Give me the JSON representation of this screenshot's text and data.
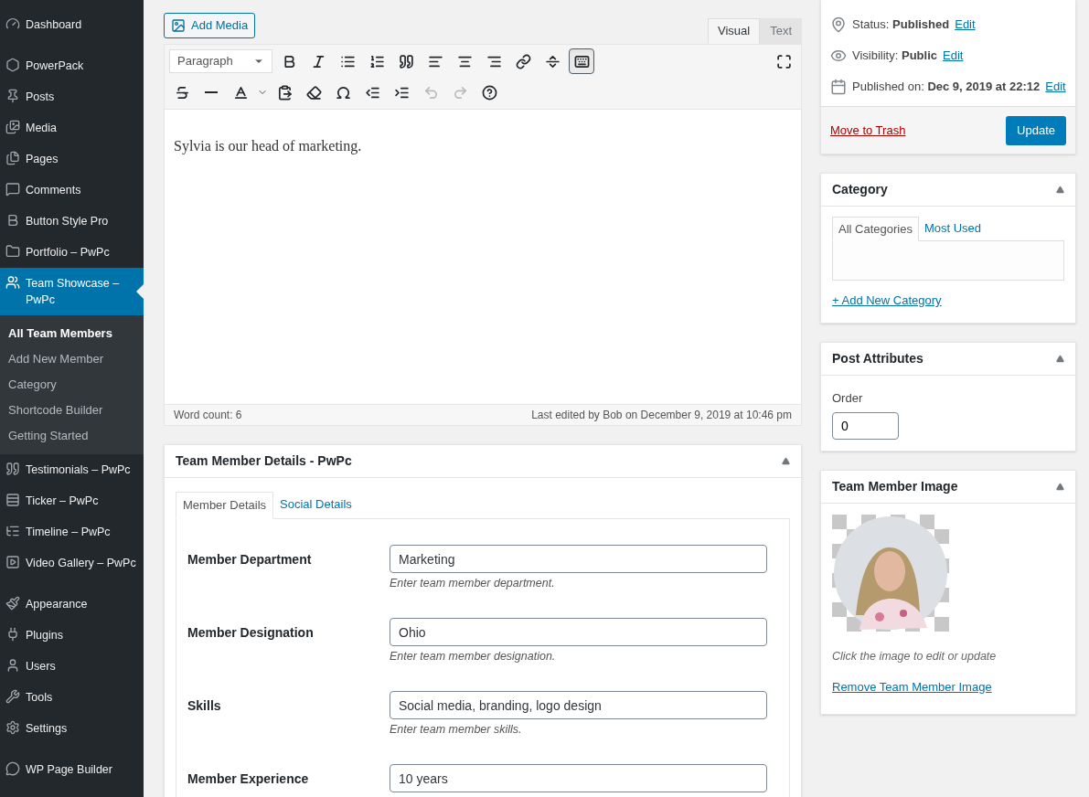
{
  "sidebar": {
    "items": [
      {
        "label": "Dashboard",
        "selected": false
      },
      {
        "label": "PowerPack",
        "selected": false
      },
      {
        "label": "Posts",
        "selected": false
      },
      {
        "label": "Media",
        "selected": false
      },
      {
        "label": "Pages",
        "selected": false
      },
      {
        "label": "Comments",
        "selected": false
      },
      {
        "label": "Button Style Pro",
        "selected": false
      },
      {
        "label": "Portfolio – PwPc",
        "selected": false
      },
      {
        "label": "Team Showcase – PwPc",
        "selected": true,
        "children": [
          {
            "label": "All Team Members",
            "selected": true
          },
          {
            "label": "Add New Member",
            "selected": false
          },
          {
            "label": "Category",
            "selected": false
          },
          {
            "label": "Shortcode Builder",
            "selected": false
          },
          {
            "label": "Getting Started",
            "selected": false
          }
        ]
      },
      {
        "label": "Testimonials – PwPc",
        "selected": false
      },
      {
        "label": "Ticker – PwPc",
        "selected": false
      },
      {
        "label": "Timeline – PwPc",
        "selected": false
      },
      {
        "label": "Video Gallery – PwPc",
        "selected": false
      },
      {
        "label": "Appearance",
        "selected": false
      },
      {
        "label": "Plugins",
        "selected": false
      },
      {
        "label": "Users",
        "selected": false
      },
      {
        "label": "Tools",
        "selected": false
      },
      {
        "label": "Settings",
        "selected": false
      },
      {
        "label": "WP Page Builder",
        "selected": false
      }
    ]
  },
  "editor": {
    "add_media": "Add Media",
    "tabs": [
      {
        "label": "Visual",
        "selected": true
      },
      {
        "label": "Text",
        "selected": false
      }
    ],
    "format": "Paragraph",
    "toolbar_toggle_pressed": true,
    "undo_disabled": true,
    "redo_disabled": true,
    "content": "Sylvia is our head of marketing.",
    "word_count": "Word count: 6",
    "last_edited": "Last edited by Bob on December 9, 2019 at 10:46 pm"
  },
  "details_box": {
    "title": "Team Member Details - PwPc",
    "tabs": [
      {
        "label": "Member Details",
        "selected": true
      },
      {
        "label": "Social Details",
        "selected": false
      }
    ],
    "fields": [
      {
        "label": "Member Department",
        "value": "Marketing",
        "description": "Enter team member department."
      },
      {
        "label": "Member Designation",
        "value": "Ohio",
        "description": "Enter team member designation."
      },
      {
        "label": "Skills",
        "value": "Social media, branding, logo design",
        "description": "Enter team member skills."
      },
      {
        "label": "Member Experience",
        "value": "10 years"
      }
    ]
  },
  "publish": {
    "rows": [
      {
        "label": "Status:",
        "value": "Published",
        "link": "Edit"
      },
      {
        "label": "Visibility:",
        "value": "Public",
        "link": "Edit"
      },
      {
        "label": "Published on:",
        "value": "Dec 9, 2019 at 22:12",
        "link": "Edit"
      }
    ],
    "trash": "Move to Trash",
    "update": "Update"
  },
  "category_box": {
    "title": "Category",
    "tabs": [
      {
        "label": "All Categories",
        "selected": true
      },
      {
        "label": "Most Used",
        "selected": false
      }
    ],
    "add_link": "+ Add New Category"
  },
  "attributes_box": {
    "title": "Post Attributes",
    "order_label": "Order",
    "order_value": "0"
  },
  "image_box": {
    "title": "Team Member Image",
    "caption": "Click the image to edit or update",
    "remove_link": "Remove Team Member Image"
  }
}
